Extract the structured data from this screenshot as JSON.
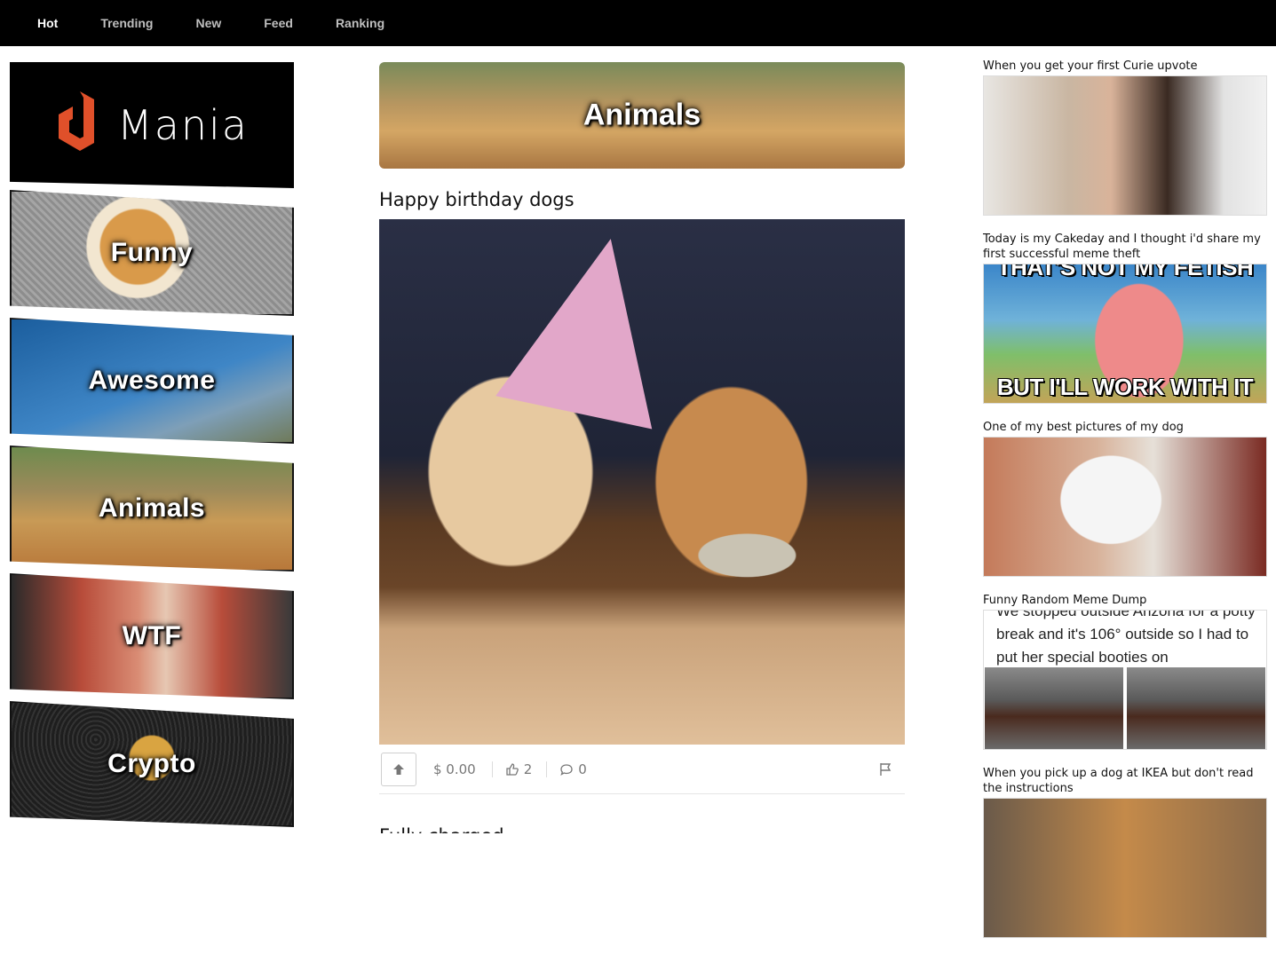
{
  "nav": {
    "items": [
      {
        "label": "Hot",
        "active": true
      },
      {
        "label": "Trending",
        "active": false
      },
      {
        "label": "New",
        "active": false
      },
      {
        "label": "Feed",
        "active": false
      },
      {
        "label": "Ranking",
        "active": false
      }
    ]
  },
  "brand": {
    "logo_text": "Mania",
    "accent": "#e0502a"
  },
  "categories": [
    {
      "label": "Funny"
    },
    {
      "label": "Awesome"
    },
    {
      "label": "Animals"
    },
    {
      "label": "WTF"
    },
    {
      "label": "Crypto"
    }
  ],
  "main": {
    "hero_label": "Animals",
    "post": {
      "title": "Happy birthday dogs",
      "payout": "$ 0.00",
      "likes": "2",
      "comments": "0"
    },
    "next_post_title": "Fully charged"
  },
  "sidebar": {
    "items": [
      {
        "title": "When you get your first Curie upvote"
      },
      {
        "title": "Today is my Cakeday and I thought i'd share my first successful meme theft",
        "meme_top": "THAT'S NOT MY FETISH",
        "meme_bottom": "BUT I'LL WORK WITH IT"
      },
      {
        "title": "One of my best pictures of my dog"
      },
      {
        "title": "Funny Random Meme Dump",
        "tweet": "We stopped outside Arizona for a potty break and it's 106° outside so I had to put her special booties on"
      },
      {
        "title": "When you pick up a dog at IKEA but don't read the instructions"
      }
    ]
  }
}
